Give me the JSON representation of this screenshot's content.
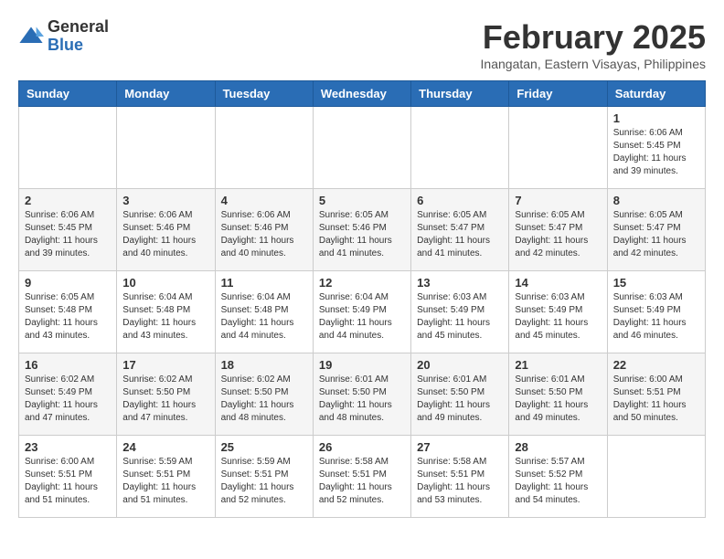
{
  "header": {
    "logo": {
      "general": "General",
      "blue": "Blue"
    },
    "title": "February 2025",
    "subtitle": "Inangatan, Eastern Visayas, Philippines"
  },
  "calendar": {
    "days_of_week": [
      "Sunday",
      "Monday",
      "Tuesday",
      "Wednesday",
      "Thursday",
      "Friday",
      "Saturday"
    ],
    "weeks": [
      [
        {
          "day": "",
          "info": ""
        },
        {
          "day": "",
          "info": ""
        },
        {
          "day": "",
          "info": ""
        },
        {
          "day": "",
          "info": ""
        },
        {
          "day": "",
          "info": ""
        },
        {
          "day": "",
          "info": ""
        },
        {
          "day": "1",
          "info": "Sunrise: 6:06 AM\nSunset: 5:45 PM\nDaylight: 11 hours and 39 minutes."
        }
      ],
      [
        {
          "day": "2",
          "info": "Sunrise: 6:06 AM\nSunset: 5:45 PM\nDaylight: 11 hours and 39 minutes."
        },
        {
          "day": "3",
          "info": "Sunrise: 6:06 AM\nSunset: 5:46 PM\nDaylight: 11 hours and 40 minutes."
        },
        {
          "day": "4",
          "info": "Sunrise: 6:06 AM\nSunset: 5:46 PM\nDaylight: 11 hours and 40 minutes."
        },
        {
          "day": "5",
          "info": "Sunrise: 6:05 AM\nSunset: 5:46 PM\nDaylight: 11 hours and 41 minutes."
        },
        {
          "day": "6",
          "info": "Sunrise: 6:05 AM\nSunset: 5:47 PM\nDaylight: 11 hours and 41 minutes."
        },
        {
          "day": "7",
          "info": "Sunrise: 6:05 AM\nSunset: 5:47 PM\nDaylight: 11 hours and 42 minutes."
        },
        {
          "day": "8",
          "info": "Sunrise: 6:05 AM\nSunset: 5:47 PM\nDaylight: 11 hours and 42 minutes."
        }
      ],
      [
        {
          "day": "9",
          "info": "Sunrise: 6:05 AM\nSunset: 5:48 PM\nDaylight: 11 hours and 43 minutes."
        },
        {
          "day": "10",
          "info": "Sunrise: 6:04 AM\nSunset: 5:48 PM\nDaylight: 11 hours and 43 minutes."
        },
        {
          "day": "11",
          "info": "Sunrise: 6:04 AM\nSunset: 5:48 PM\nDaylight: 11 hours and 44 minutes."
        },
        {
          "day": "12",
          "info": "Sunrise: 6:04 AM\nSunset: 5:49 PM\nDaylight: 11 hours and 44 minutes."
        },
        {
          "day": "13",
          "info": "Sunrise: 6:03 AM\nSunset: 5:49 PM\nDaylight: 11 hours and 45 minutes."
        },
        {
          "day": "14",
          "info": "Sunrise: 6:03 AM\nSunset: 5:49 PM\nDaylight: 11 hours and 45 minutes."
        },
        {
          "day": "15",
          "info": "Sunrise: 6:03 AM\nSunset: 5:49 PM\nDaylight: 11 hours and 46 minutes."
        }
      ],
      [
        {
          "day": "16",
          "info": "Sunrise: 6:02 AM\nSunset: 5:49 PM\nDaylight: 11 hours and 47 minutes."
        },
        {
          "day": "17",
          "info": "Sunrise: 6:02 AM\nSunset: 5:50 PM\nDaylight: 11 hours and 47 minutes."
        },
        {
          "day": "18",
          "info": "Sunrise: 6:02 AM\nSunset: 5:50 PM\nDaylight: 11 hours and 48 minutes."
        },
        {
          "day": "19",
          "info": "Sunrise: 6:01 AM\nSunset: 5:50 PM\nDaylight: 11 hours and 48 minutes."
        },
        {
          "day": "20",
          "info": "Sunrise: 6:01 AM\nSunset: 5:50 PM\nDaylight: 11 hours and 49 minutes."
        },
        {
          "day": "21",
          "info": "Sunrise: 6:01 AM\nSunset: 5:50 PM\nDaylight: 11 hours and 49 minutes."
        },
        {
          "day": "22",
          "info": "Sunrise: 6:00 AM\nSunset: 5:51 PM\nDaylight: 11 hours and 50 minutes."
        }
      ],
      [
        {
          "day": "23",
          "info": "Sunrise: 6:00 AM\nSunset: 5:51 PM\nDaylight: 11 hours and 51 minutes."
        },
        {
          "day": "24",
          "info": "Sunrise: 5:59 AM\nSunset: 5:51 PM\nDaylight: 11 hours and 51 minutes."
        },
        {
          "day": "25",
          "info": "Sunrise: 5:59 AM\nSunset: 5:51 PM\nDaylight: 11 hours and 52 minutes."
        },
        {
          "day": "26",
          "info": "Sunrise: 5:58 AM\nSunset: 5:51 PM\nDaylight: 11 hours and 52 minutes."
        },
        {
          "day": "27",
          "info": "Sunrise: 5:58 AM\nSunset: 5:51 PM\nDaylight: 11 hours and 53 minutes."
        },
        {
          "day": "28",
          "info": "Sunrise: 5:57 AM\nSunset: 5:52 PM\nDaylight: 11 hours and 54 minutes."
        },
        {
          "day": "",
          "info": ""
        }
      ]
    ]
  }
}
